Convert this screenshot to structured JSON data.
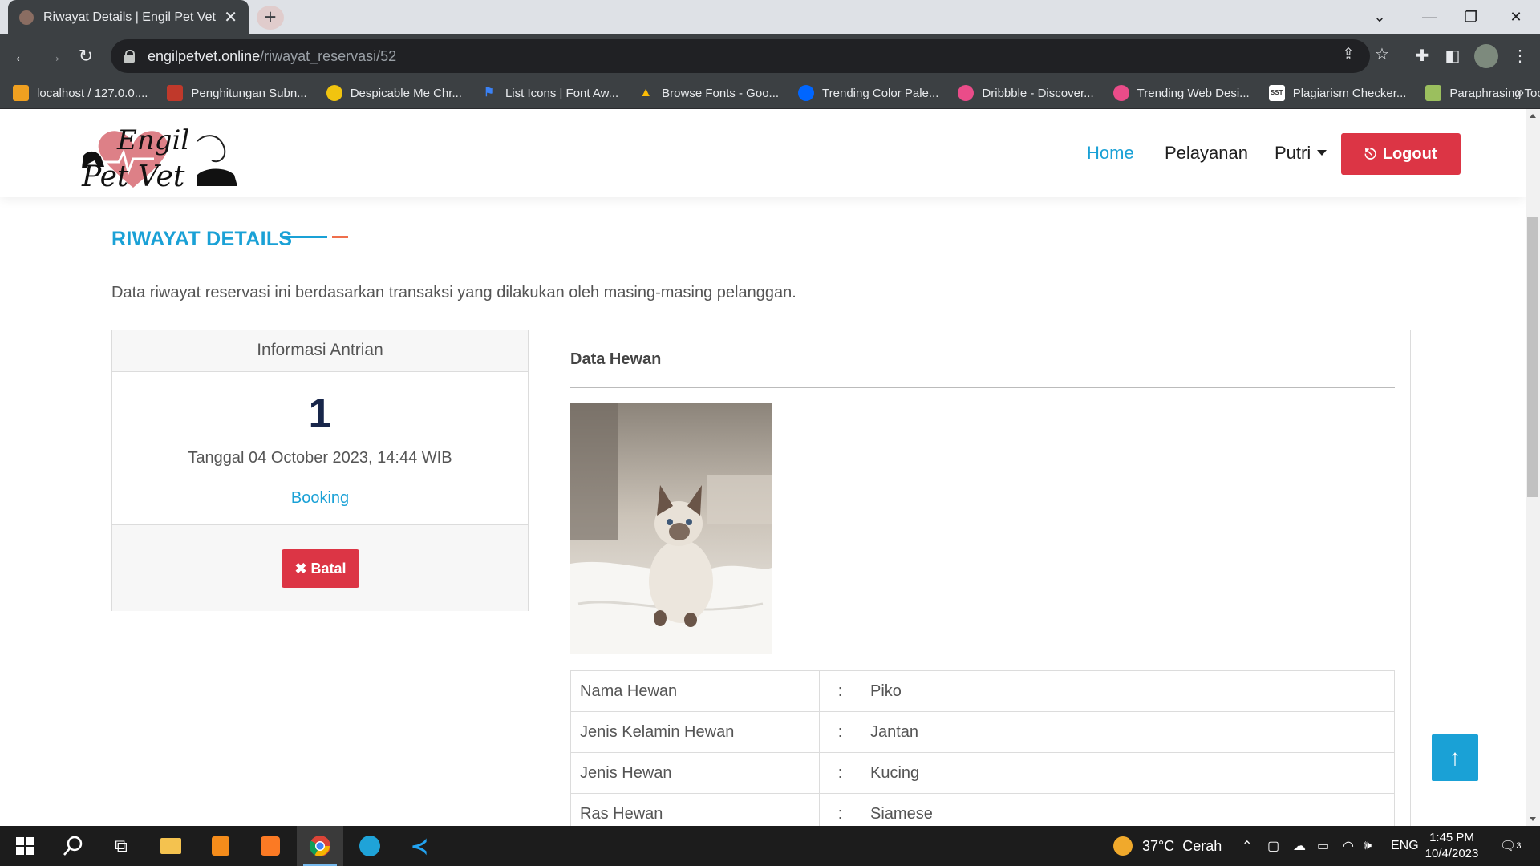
{
  "browser": {
    "tab_title": "Riwayat Details | Engil Pet Vet",
    "url_host": "engilpetvet.online",
    "url_path": "/riwayat_reservasi/52",
    "bookmarks": [
      {
        "label": "localhost / 127.0.0....",
        "icon": "phpmyadmin-icon",
        "color": "#f0a020"
      },
      {
        "label": "Penghitungan Subn...",
        "icon": "rsw-icon",
        "color": "#c0392b"
      },
      {
        "label": "Despicable Me Chr...",
        "icon": "minion-icon",
        "color": "#f1c40f"
      },
      {
        "label": "List Icons | Font Aw...",
        "icon": "flag-icon",
        "color": "#3b82f6"
      },
      {
        "label": "Browse Fonts - Goo...",
        "icon": "google-fonts-icon",
        "color": "#4285f4"
      },
      {
        "label": "Trending Color Pale...",
        "icon": "coolors-icon",
        "color": "#0066ff"
      },
      {
        "label": "Dribbble - Discover...",
        "icon": "dribbble-icon",
        "color": "#ea4c89"
      },
      {
        "label": "Trending Web Desi...",
        "icon": "dribbble-icon",
        "color": "#ea4c89"
      },
      {
        "label": "Plagiarism Checker...",
        "icon": "sst-icon",
        "color": "#ffffff"
      },
      {
        "label": "Paraphrasing Tool",
        "icon": "quillbot-icon",
        "color": "#9bbf5e"
      }
    ]
  },
  "header": {
    "logo_line1": "Engil",
    "logo_line2": "Pet Vet",
    "nav": {
      "home": "Home",
      "services": "Pelayanan",
      "user": "Putri"
    },
    "logout_label": "Logout"
  },
  "main": {
    "section_title": "RIWAYAT DETAILS",
    "description": "Data riwayat reservasi ini berdasarkan transaksi yang dilakukan oleh masing-masing pelanggan.",
    "queue": {
      "heading": "Informasi Antrian",
      "number": "1",
      "date": "Tanggal 04 October 2023, 14:44 WIB",
      "status": "Booking",
      "cancel_label": "Batal"
    },
    "pet": {
      "heading": "Data Hewan",
      "rows": [
        {
          "label": "Nama Hewan",
          "sep": ":",
          "value": "Piko"
        },
        {
          "label": "Jenis Kelamin Hewan",
          "sep": ":",
          "value": "Jantan"
        },
        {
          "label": "Jenis Hewan",
          "sep": ":",
          "value": "Kucing"
        },
        {
          "label": "Ras Hewan",
          "sep": ":",
          "value": "Siamese"
        }
      ]
    }
  },
  "taskbar": {
    "temperature": "37°C",
    "weather": "Cerah",
    "language": "ENG",
    "time": "1:45 PM",
    "date": "10/4/2023",
    "notifications": "3"
  },
  "colors": {
    "accent": "#1aa1d6",
    "danger": "#dc3545",
    "accent2": "#ef6f4c"
  }
}
